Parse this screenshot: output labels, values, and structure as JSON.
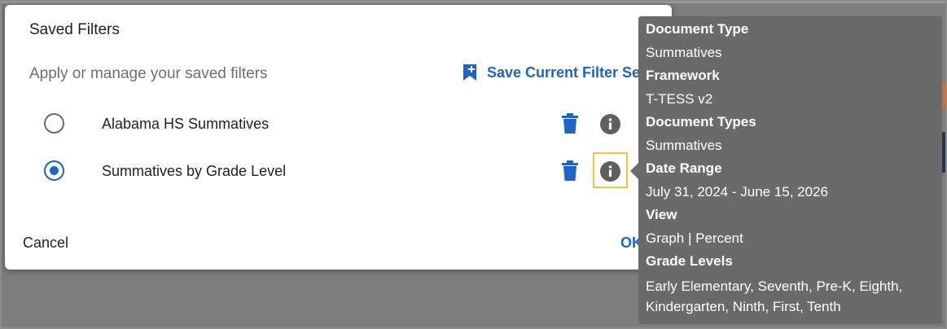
{
  "dialog": {
    "title": "Saved Filters",
    "subtitle": "Apply or manage your saved filters",
    "save_current": "Save Current Filter Set",
    "cancel": "Cancel",
    "ok": "OK"
  },
  "filters": [
    {
      "label": "Alabama HS Summatives",
      "selected": false
    },
    {
      "label": "Summatives by Grade Level",
      "selected": true
    }
  ],
  "tooltip": {
    "items": [
      {
        "label": "Document Type",
        "value": "Summatives"
      },
      {
        "label": "Framework",
        "value": "T-TESS v2"
      },
      {
        "label": "Document Types",
        "value": "Summatives"
      },
      {
        "label": "Date Range",
        "value": "July 31, 2024 - June 15, 2026"
      },
      {
        "label": "View",
        "value": "Graph | Percent"
      },
      {
        "label": "Grade Levels",
        "value_line1": "Early Elementary, Seventh, Pre-K, Eighth,",
        "value_line2": "Kindergarten, Ninth, First, Tenth"
      }
    ]
  },
  "colors": {
    "accent": "#1f63c6",
    "focus": "#f0c14b",
    "tooltip_bg": "#6a6a6a"
  },
  "icons": {
    "save": "bookmark-add-icon",
    "delete": "trash-icon",
    "info": "info-icon"
  }
}
